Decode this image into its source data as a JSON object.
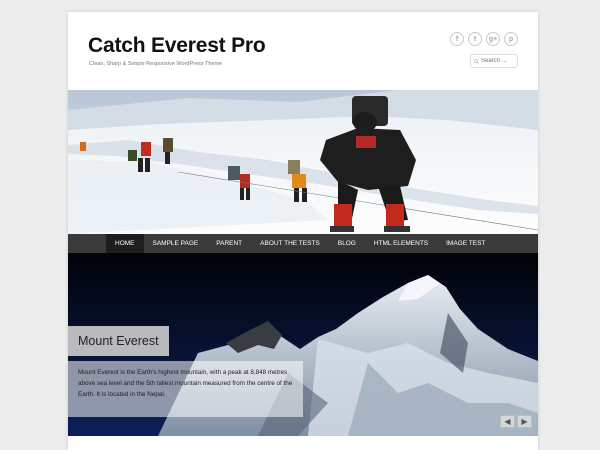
{
  "site": {
    "title": "Catch Everest Pro",
    "tagline": "Clean, Sharp & Simple Responsive WordPress Theme"
  },
  "social": [
    {
      "icon": "facebook-icon",
      "glyph": "f"
    },
    {
      "icon": "twitter-icon",
      "glyph": "t"
    },
    {
      "icon": "google-plus-icon",
      "glyph": "g+"
    },
    {
      "icon": "pinterest-icon",
      "glyph": "p"
    }
  ],
  "search": {
    "placeholder": "Search ..."
  },
  "nav": {
    "items": [
      "HOME",
      "SAMPLE PAGE",
      "PARENT",
      "ABOUT THE TESTS",
      "BLOG",
      "HTML ELEMENTS",
      "IMAGE TEST"
    ],
    "active": "HOME"
  },
  "slider": {
    "title": "Mount Everest",
    "caption": "Mount Everest is the Earth's highest mountain, with a peak at 8,848 metres above sea level and the 5th tallest mountain measured from the centre of the Earth. It is located in the Nepal.",
    "prev_glyph": "◀",
    "next_glyph": "▶"
  },
  "colors": {
    "nav_bg": "#3a3a3a",
    "nav_active_bg": "#1e1e1e",
    "page_bg": "#ececec"
  }
}
